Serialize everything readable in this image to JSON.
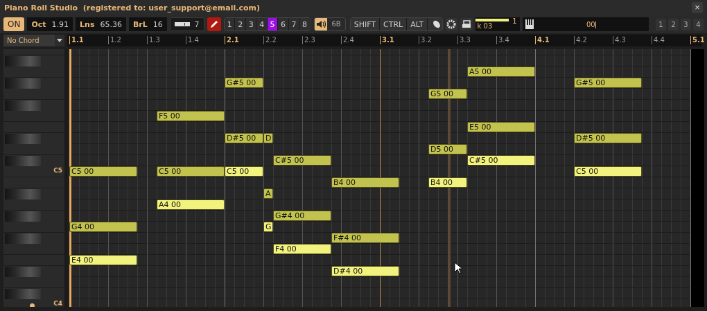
{
  "window": {
    "title": "Piano Roll Studio  (registered to: user_support@email.com)",
    "close": "×"
  },
  "toolbar": {
    "power": {
      "label": "ON",
      "on": true
    },
    "fields": [
      {
        "label": "Oct",
        "value": "1.91"
      },
      {
        "label": "Lns",
        "value": "65.36"
      },
      {
        "label": "BrL",
        "value": "16"
      }
    ],
    "velocity": {
      "value": "7"
    },
    "pencil": {
      "on": true
    },
    "channels": [
      {
        "label": "1",
        "selected": false
      },
      {
        "label": "2",
        "selected": false
      },
      {
        "label": "3",
        "selected": false
      },
      {
        "label": "4",
        "selected": false
      },
      {
        "label": "5",
        "selected": true
      },
      {
        "label": "6",
        "selected": false
      },
      {
        "label": "7",
        "selected": false
      },
      {
        "label": "8",
        "selected": false
      }
    ],
    "sound": {
      "on": true,
      "value": "6B"
    },
    "modifiers": [
      {
        "label": "SHIFT"
      },
      {
        "label": "CTRL"
      },
      {
        "label": "ALT"
      }
    ],
    "meter": {
      "level": 0.75,
      "value": "1",
      "label": "k 03"
    },
    "input": {
      "value": "00",
      "focused": true
    },
    "layers": [
      {
        "label": "1"
      },
      {
        "label": "2"
      },
      {
        "label": "3"
      },
      {
        "label": "4"
      }
    ]
  },
  "chord": {
    "value": "No Chord"
  },
  "ruler": {
    "marks": [
      {
        "label": "1.1",
        "kind": "bar"
      },
      {
        "label": "1.2",
        "kind": "beat"
      },
      {
        "label": "1.3",
        "kind": "beat"
      },
      {
        "label": "1.4",
        "kind": "beat"
      },
      {
        "label": "2.1",
        "kind": "bar"
      },
      {
        "label": "2.2",
        "kind": "beat"
      },
      {
        "label": "2.3",
        "kind": "beat"
      },
      {
        "label": "2.4",
        "kind": "beat"
      },
      {
        "label": "3.1",
        "kind": "bar"
      },
      {
        "label": "3.2",
        "kind": "beat"
      },
      {
        "label": "3.3",
        "kind": "beat"
      },
      {
        "label": "3.4",
        "kind": "beat"
      },
      {
        "label": "4.1",
        "kind": "bar"
      },
      {
        "label": "4.2",
        "kind": "beat"
      },
      {
        "label": "4.3",
        "kind": "beat"
      },
      {
        "label": "4.4",
        "kind": "beat"
      },
      {
        "label": "5.1",
        "kind": "bar"
      }
    ]
  },
  "lanes": [
    {
      "kind": "white"
    },
    {
      "kind": "black"
    },
    {
      "kind": "white",
      "notes": [
        {
          "label": "A5 00",
          "selected": false
        }
      ]
    },
    {
      "kind": "black",
      "notes": [
        {
          "label": "G#5 00",
          "selected": false
        },
        {
          "label": "G#5 00",
          "selected": false
        }
      ]
    },
    {
      "kind": "white",
      "notes": [
        {
          "label": "G5 00",
          "selected": false
        }
      ]
    },
    {
      "kind": "black"
    },
    {
      "kind": "white",
      "notes": [
        {
          "label": "F5 00",
          "selected": false
        }
      ]
    },
    {
      "kind": "white",
      "notes": [
        {
          "label": "E5 00",
          "selected": false
        }
      ]
    },
    {
      "kind": "black",
      "notes": [
        {
          "label": "D#5 00",
          "selected": false
        },
        {
          "label": "D",
          "selected": false
        },
        {
          "label": "D#5 00",
          "selected": false
        }
      ]
    },
    {
      "kind": "white",
      "notes": [
        {
          "label": "D5 00",
          "selected": false
        }
      ]
    },
    {
      "kind": "black",
      "notes": [
        {
          "label": "C#5 00",
          "selected": false
        },
        {
          "label": "C#5 00",
          "selected": true
        }
      ]
    },
    {
      "kind": "white",
      "key_label": "C5",
      "notes": [
        {
          "label": "C5 00",
          "selected": false
        },
        {
          "label": "C5 00",
          "selected": false
        },
        {
          "label": "C5 00",
          "selected": true
        },
        {
          "label": "C5 00",
          "selected": true
        }
      ]
    },
    {
      "kind": "white",
      "notes": [
        {
          "label": "B4 00",
          "selected": false
        },
        {
          "label": "B4 00",
          "selected": true
        }
      ]
    },
    {
      "kind": "black",
      "notes": [
        {
          "label": "A",
          "selected": false
        }
      ]
    },
    {
      "kind": "white",
      "notes": [
        {
          "label": "A4 00",
          "selected": true
        }
      ]
    },
    {
      "kind": "black",
      "notes": [
        {
          "label": "G#4 00",
          "selected": false
        }
      ]
    },
    {
      "kind": "white",
      "notes": [
        {
          "label": "G4 00",
          "selected": false
        },
        {
          "label": "G",
          "selected": true
        }
      ]
    },
    {
      "kind": "black",
      "notes": [
        {
          "label": "F#4 00",
          "selected": false
        }
      ]
    },
    {
      "kind": "white",
      "notes": [
        {
          "label": "F4 00",
          "selected": true
        }
      ]
    },
    {
      "kind": "white",
      "notes": [
        {
          "label": "E4 00",
          "selected": true
        }
      ]
    },
    {
      "kind": "black",
      "notes": [
        {
          "label": "D#4 00",
          "selected": true
        }
      ]
    },
    {
      "kind": "white"
    },
    {
      "kind": "black"
    },
    {
      "kind": "white",
      "key_label": "C4"
    }
  ]
}
